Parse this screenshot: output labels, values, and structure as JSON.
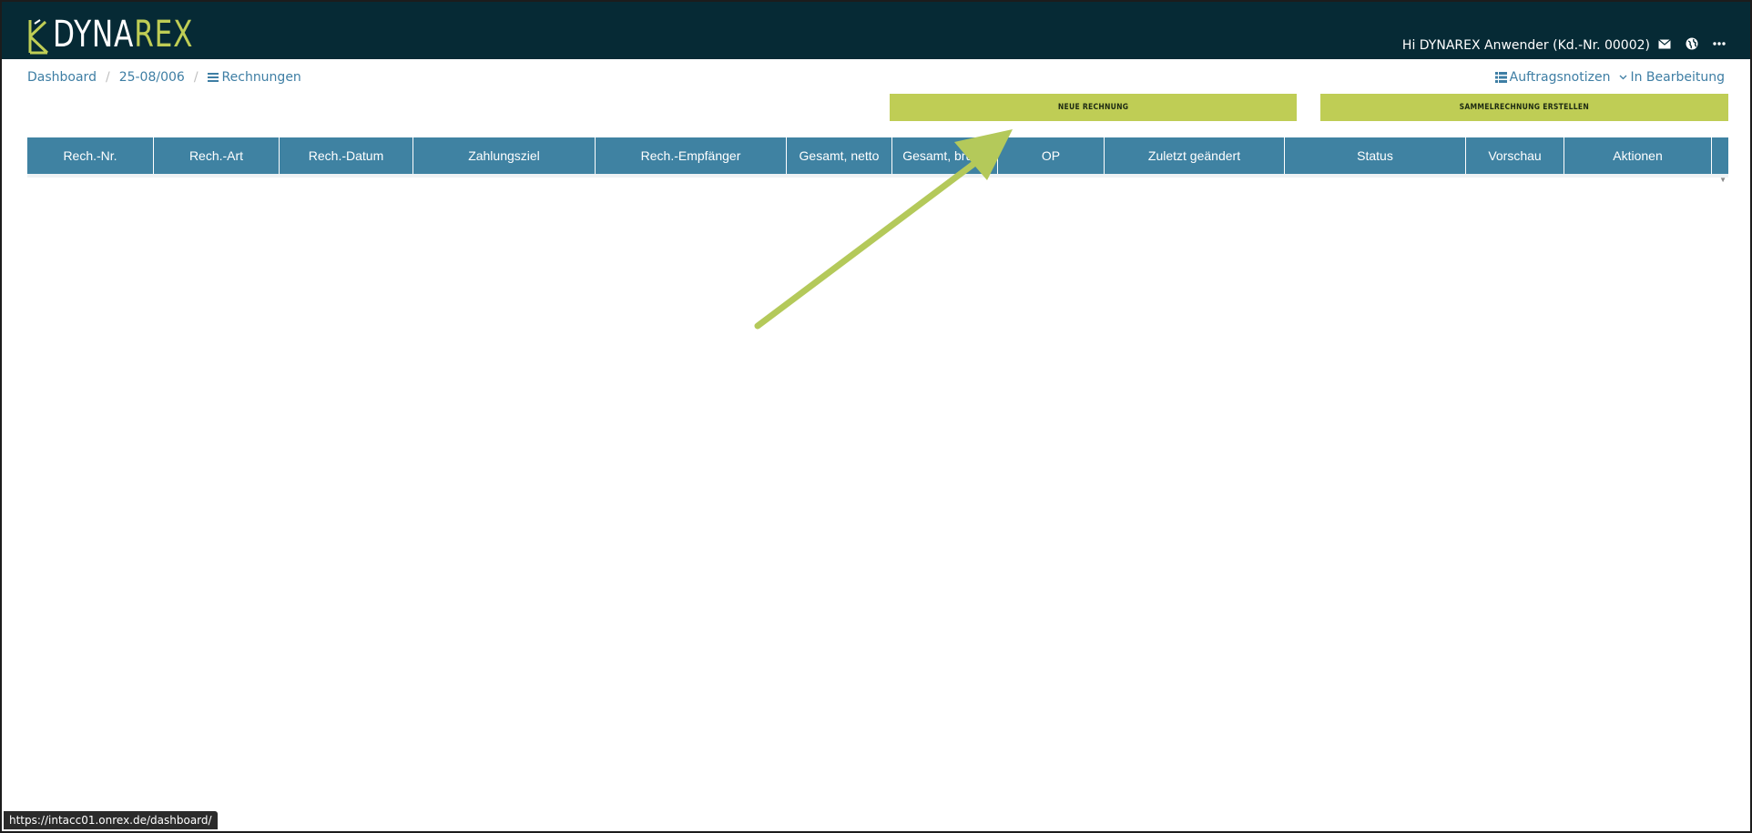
{
  "header": {
    "logo_dyna": "DYNA",
    "logo_rex": "REX",
    "greeting": "Hi DYNAREX Anwender (Kd.-Nr. 00002)",
    "icons": [
      "mail-icon",
      "globe-icon",
      "more-icon"
    ]
  },
  "breadcrumb": {
    "items": [
      "Dashboard",
      "25-08/006",
      "Rechnungen"
    ],
    "separator": "/"
  },
  "rightlinks": {
    "notes": "Auftragsnotizen",
    "status": "In Bearbeitung"
  },
  "buttons": {
    "new_invoice": "NEUE RECHNUNG",
    "collective_invoice": "SAMMELRECHNUNG ERSTELLEN"
  },
  "table": {
    "columns": [
      "Rech.-Nr.",
      "Rech.-Art",
      "Rech.-Datum",
      "Zahlungsziel",
      "Rech.-Empfänger",
      "Gesamt, netto",
      "Gesamt, brutto",
      "OP",
      "Zuletzt geändert",
      "Status",
      "Vorschau",
      "Aktionen"
    ],
    "rows": []
  },
  "statusbar": {
    "url": "https://intacc01.onrex.de/dashboard/"
  },
  "colors": {
    "header_bg": "#062a35",
    "accent_green": "#bfcd55",
    "table_header": "#3f82a2",
    "link_blue": "#3e7ea4"
  }
}
